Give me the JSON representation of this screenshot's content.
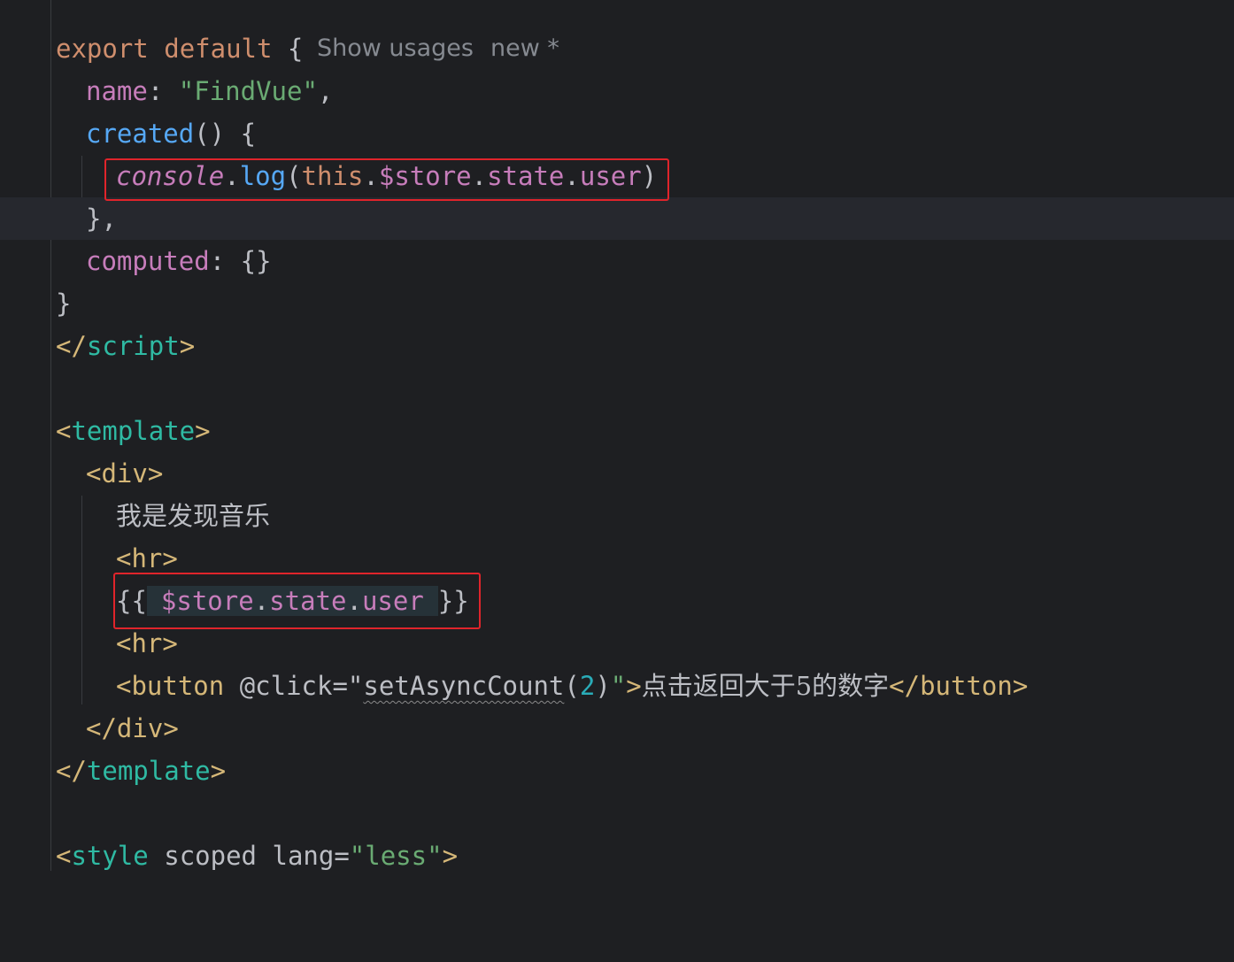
{
  "hints": {
    "show_usages": "Show usages",
    "new_marker": "new *"
  },
  "code": {
    "export_kw": "export",
    "default_kw": "default",
    "open_brace": "{",
    "name_key": "name",
    "name_value": "\"FindVue\"",
    "created_fn": "created",
    "console": "console",
    "log": "log",
    "this_kw": "this",
    "store": "$store",
    "state": "state",
    "user": "user",
    "close_created": "},",
    "computed_key": "computed",
    "computed_value": "{}",
    "close_export": "}",
    "script_close_tag": "script",
    "template_tag": "template",
    "div_tag": "div",
    "static_text": "我是发现音乐",
    "hr_tag": "hr",
    "mustache_open": "{{",
    "mustache_close": "}}",
    "button_tag": "button",
    "click_attr": "@click",
    "handler_fn": "setAsyncCount",
    "handler_arg": "2",
    "button_text": "点击返回大于5的数字",
    "style_tag": "style",
    "scoped_attr": "scoped",
    "lang_attr": "lang",
    "lang_value": "\"less\""
  },
  "colors": {
    "background": "#1e1f22",
    "keyword": "#cf8e6d",
    "property": "#c77dbb",
    "string": "#6aab73",
    "function": "#56a8f5",
    "tag": "#2fbaa3",
    "highlight_box": "#e0242b"
  }
}
